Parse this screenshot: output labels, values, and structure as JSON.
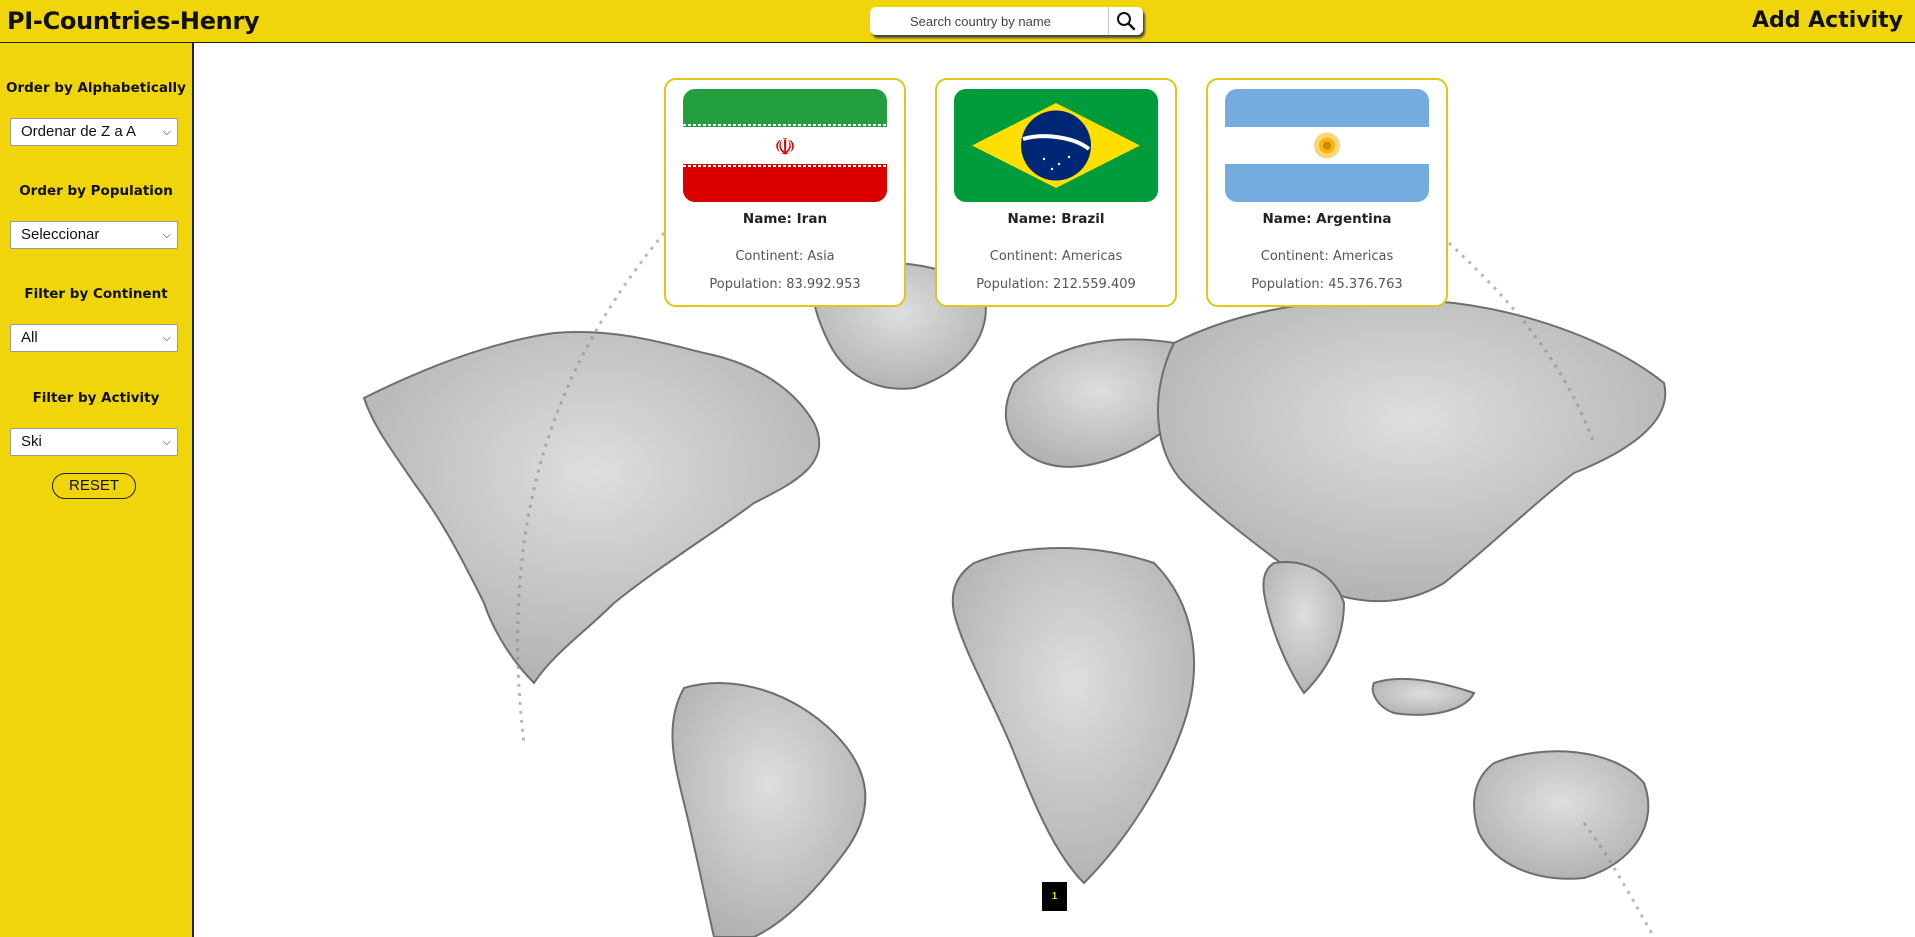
{
  "header": {
    "brand": "PI-Countries-Henry",
    "search_placeholder": "Search country by name",
    "search_icon": "search-icon",
    "add_activity": "Add Activity"
  },
  "sidebar": {
    "order_alpha": {
      "label": "Order by Alphabetically",
      "selected": "Ordenar de Z a A"
    },
    "order_population": {
      "label": "Order by Population",
      "selected": "Seleccionar"
    },
    "filter_continent": {
      "label": "Filter by Continent",
      "selected": "All"
    },
    "filter_activity": {
      "label": "Filter by Activity",
      "selected": "Ski"
    },
    "reset": "RESET"
  },
  "cards": [
    {
      "name": "Name: Iran",
      "continent": "Continent: Asia",
      "population": "Population: 83.992.953",
      "flag": "iran-flag"
    },
    {
      "name": "Name: Brazil",
      "continent": "Continent: Americas",
      "population": "Population: 212.559.409",
      "flag": "brazil-flag"
    },
    {
      "name": "Name: Argentina",
      "continent": "Continent: Americas",
      "population": "Population: 45.376.763",
      "flag": "argentina-flag"
    }
  ],
  "pagination": {
    "current_page": "1"
  },
  "colors": {
    "accent": "#f0d50b",
    "card_border": "#e0c51a"
  }
}
